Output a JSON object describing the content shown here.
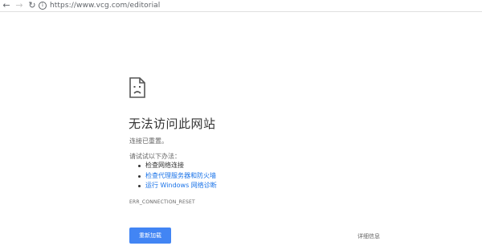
{
  "browser": {
    "url": "https://www.vcg.com/editorial",
    "back_icon": "back-arrow-icon",
    "forward_icon": "forward-arrow-icon",
    "reload_icon": "reload-icon",
    "info_icon": "info-icon"
  },
  "error_page": {
    "icon": "sad-page-icon",
    "title": "无法访问此网站",
    "subtitle": "连接已重置。",
    "suggestions_label": "请试试以下办法：",
    "suggestions": [
      {
        "text": "检查网络连接",
        "link": false
      },
      {
        "text": "检查代理服务器和防火墙",
        "link": true
      },
      {
        "text": "运行 Windows 网络诊断",
        "link": true
      }
    ],
    "error_code": "ERR_CONNECTION_RESET",
    "reload_button": "重新加载",
    "details_button": "详细信息"
  },
  "colors": {
    "link": "#1a73e8",
    "button_bg": "#4285f4"
  }
}
